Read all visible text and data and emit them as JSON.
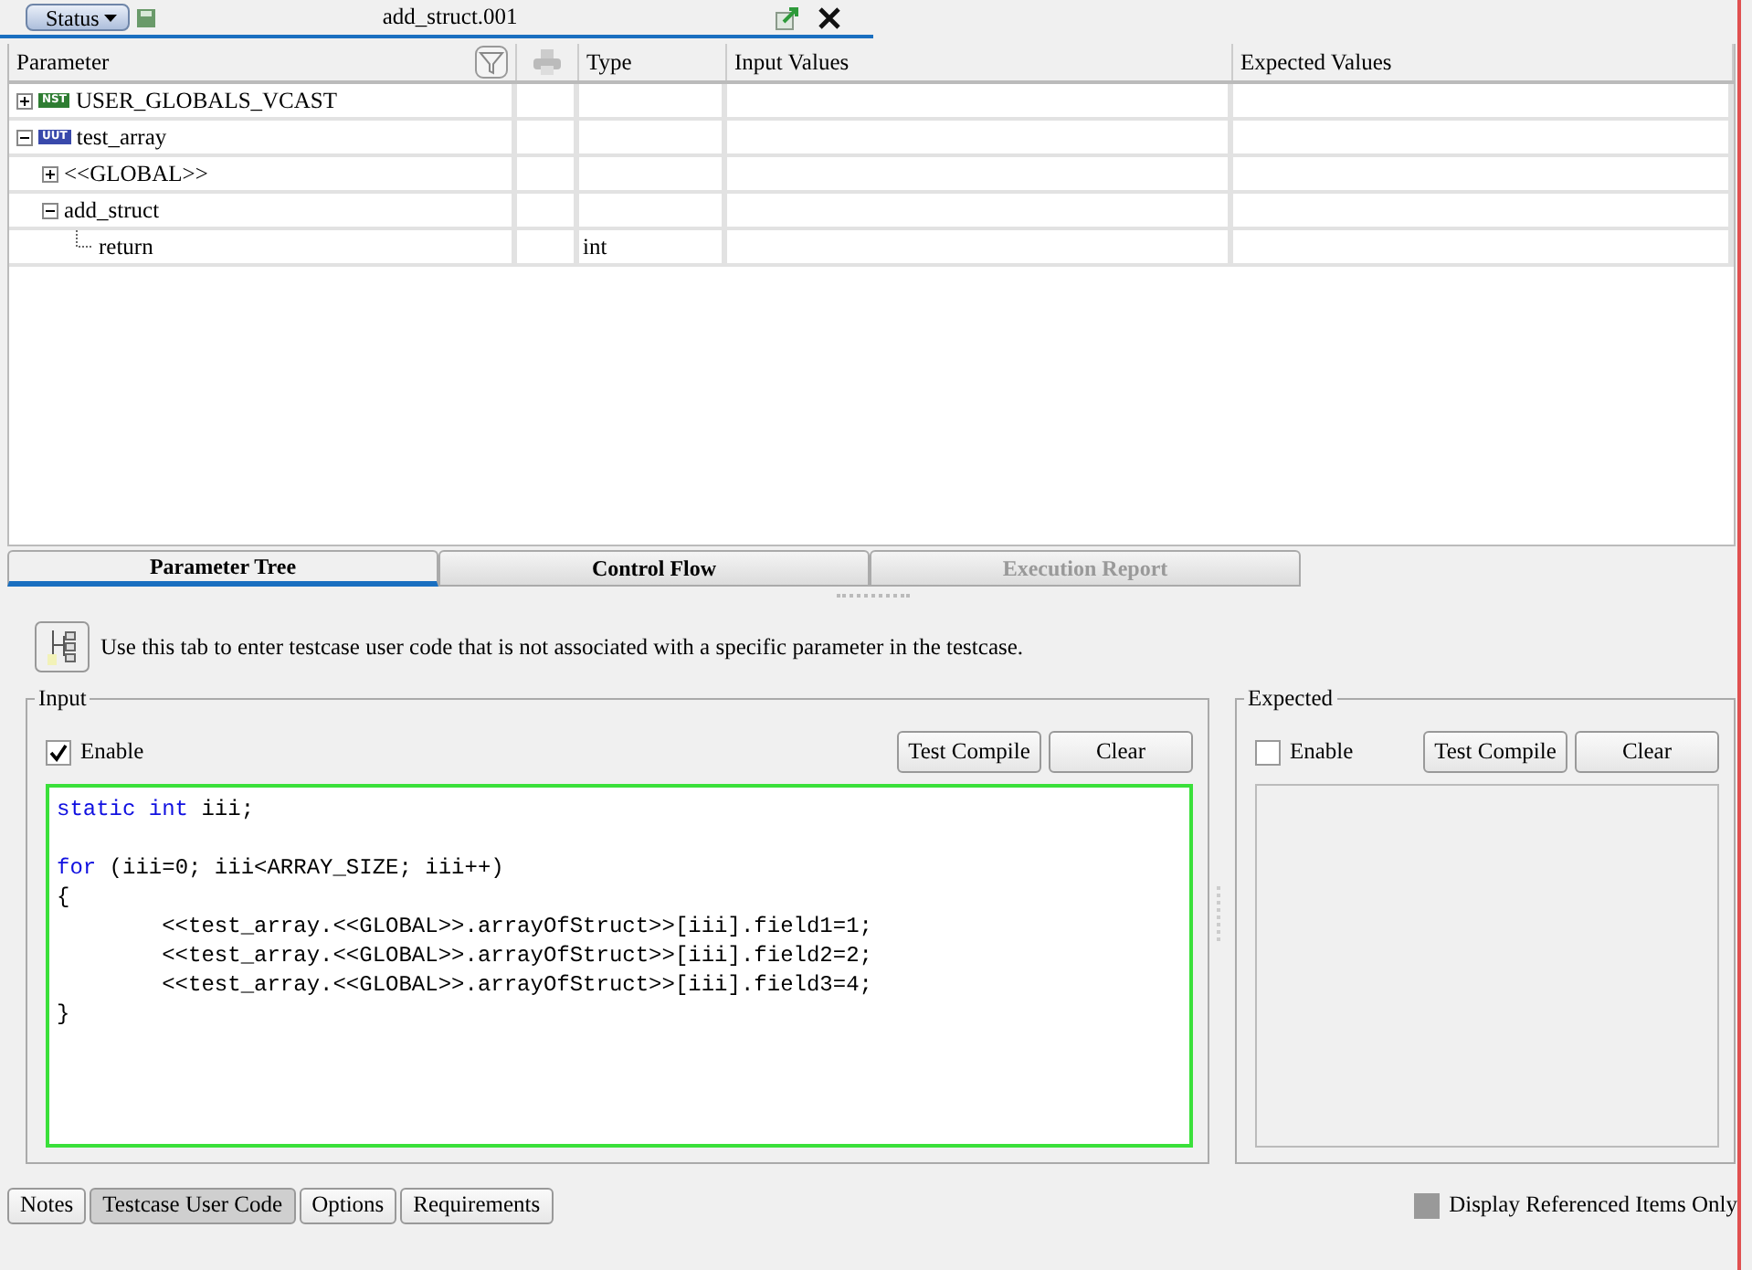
{
  "header": {
    "status_button": "Status",
    "title": "add_struct.001"
  },
  "table": {
    "columns": [
      "Parameter",
      "Type",
      "Input Values",
      "Expected Values"
    ],
    "rows": [
      {
        "name": "USER_GLOBALS_VCAST",
        "badge": "NST",
        "color": "#2e7d32",
        "expanded": false
      },
      {
        "name": "test_array",
        "badge": "UUT",
        "color": "#3949ab",
        "expanded": true,
        "children": [
          {
            "name": "<<GLOBAL>>",
            "expanded": false
          },
          {
            "name": "add_struct",
            "expanded": true,
            "children": [
              {
                "name": "return",
                "type": "int"
              }
            ]
          }
        ]
      }
    ]
  },
  "view_tabs": [
    {
      "label": "Parameter Tree",
      "selected": true,
      "disabled": false
    },
    {
      "label": "Control Flow",
      "selected": false,
      "disabled": false
    },
    {
      "label": "Execution Report",
      "selected": false,
      "disabled": true
    }
  ],
  "info": "Use this tab to enter testcase user code that is not associated with a specific parameter in the testcase.",
  "input": {
    "title": "Input",
    "enable_label": "Enable",
    "enabled": true,
    "buttons": [
      "Test Compile",
      "Clear"
    ],
    "code": [
      {
        "segments": [
          {
            "kind": "keyword",
            "text": "static int"
          },
          {
            "kind": "plain",
            "text": " iii;"
          }
        ]
      },
      {
        "space_before": true,
        "segments": [
          {
            "kind": "keyword",
            "text": "for"
          },
          {
            "kind": "plain",
            "text": " (iii=0; iii<ARRAY_SIZE; iii++)"
          }
        ]
      },
      {
        "segments": [
          {
            "kind": "plain",
            "text": "{"
          }
        ]
      },
      {
        "segments": [
          {
            "kind": "plain",
            "text": "        <<test_array.<<GLOBAL>>.arrayOfStruct>>[iii].field1=1;"
          }
        ]
      },
      {
        "segments": [
          {
            "kind": "plain",
            "text": "        <<test_array.<<GLOBAL>>.arrayOfStruct>>[iii].field2=2;"
          }
        ]
      },
      {
        "segments": [
          {
            "kind": "plain",
            "text": "        <<test_array.<<GLOBAL>>.arrayOfStruct>>[iii].field3=4;"
          }
        ]
      },
      {
        "segments": [
          {
            "kind": "plain",
            "text": "}"
          }
        ]
      }
    ]
  },
  "expected": {
    "title": "Expected",
    "enable_label": "Enable",
    "enabled": false,
    "buttons": [
      "Test Compile",
      "Clear"
    ]
  },
  "bottom_tabs": [
    {
      "label": "Notes",
      "selected": false
    },
    {
      "label": "Testcase User Code",
      "selected": true
    },
    {
      "label": "Options",
      "selected": false
    },
    {
      "label": "Requirements",
      "selected": false
    }
  ],
  "display_referenced": {
    "label": "Display Referenced Items Only",
    "disabled": true
  }
}
